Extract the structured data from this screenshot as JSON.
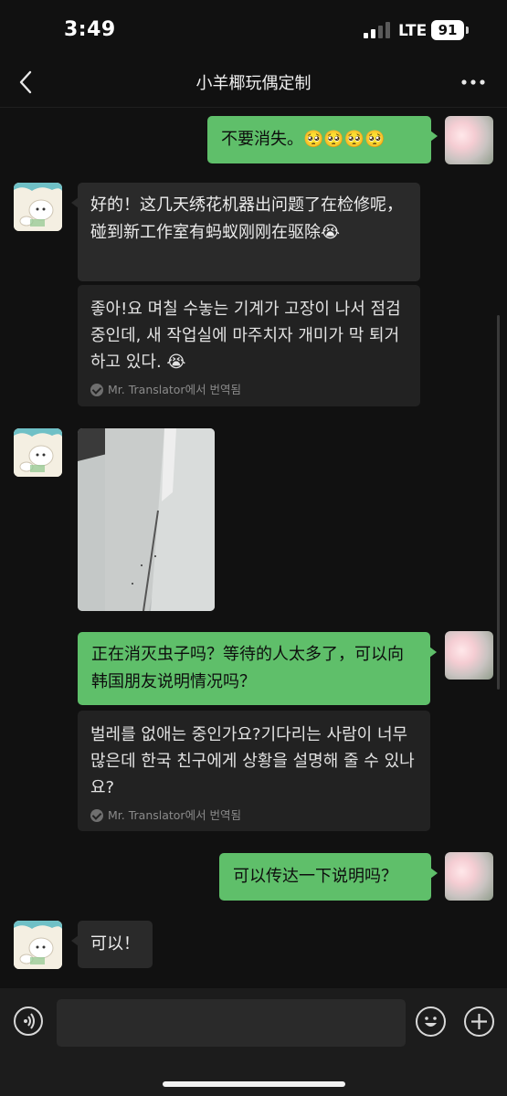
{
  "status_bar": {
    "time": "3:49",
    "network": "LTE",
    "battery": "91"
  },
  "header": {
    "title": "小羊椰玩偶定制"
  },
  "messages": [
    {
      "side": "right",
      "type": "text",
      "text": "不要消失。🥺🥺🥺🥺"
    },
    {
      "side": "left",
      "type": "text",
      "text": "好的！这几天绣花机器出问题了在检修呢，碰到新工作室有蚂蚁刚刚在驱除😭",
      "translation": "좋아!요 며칠 수놓는 기계가 고장이 나서 점검 중인데, 새 작업실에 마주치자 개미가 막 퇴거하고 있다. 😭",
      "translation_note": "Mr. Translator에서 번역됨"
    },
    {
      "side": "left",
      "type": "image"
    },
    {
      "side": "right",
      "type": "text",
      "text": "正在消灭虫子吗？等待的人太多了，可以向韩国朋友说明情况吗？",
      "translation": "벌레를 없애는 중인가요?기다리는 사람이 너무 많은데 한국 친구에게 상황을 설명해 줄 수 있나요?",
      "translation_note": "Mr. Translator에서 번역됨"
    },
    {
      "side": "right",
      "type": "text",
      "text": "可以传达一下说明吗？"
    },
    {
      "side": "left",
      "type": "text",
      "text": "可以！"
    }
  ],
  "input": {
    "placeholder": ""
  },
  "colors": {
    "accent_green": "#5fbf6a",
    "background": "#111111",
    "bubble_dark": "#2a2a2a"
  },
  "icons": [
    "back-arrow-icon",
    "more-icon",
    "voice-icon",
    "emoji-icon",
    "plus-icon",
    "translate-check-icon"
  ]
}
